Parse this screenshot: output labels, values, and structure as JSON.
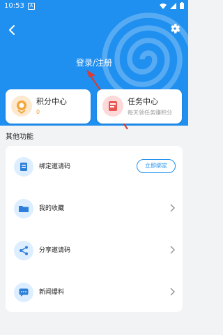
{
  "status_bar": {
    "time": "10:53",
    "notif_char": "A"
  },
  "header": {
    "login_label": "登录/注册"
  },
  "cards": [
    {
      "title": "积分中心",
      "subtitle": "0"
    },
    {
      "title": "任务中心",
      "subtitle": "每天领任务赚积分"
    }
  ],
  "section": {
    "title": "其他功能"
  },
  "features": [
    {
      "label": "绑定邀请码",
      "action_label": "立即绑定"
    },
    {
      "label": "我的收藏"
    },
    {
      "label": "分享邀请码"
    },
    {
      "label": "新闻爆料"
    }
  ],
  "colors": {
    "primary": "#1f8ff0",
    "accent": "#f19a2a"
  }
}
